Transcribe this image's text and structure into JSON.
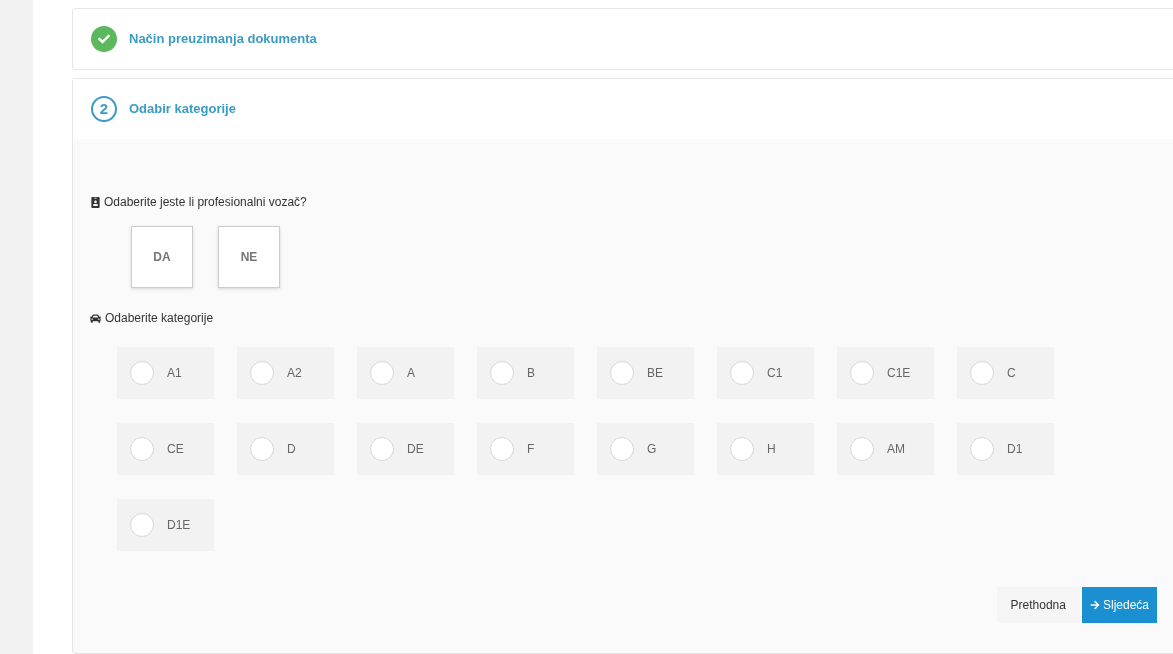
{
  "steps": [
    {
      "kind": "done",
      "title": "Način preuzimanja dokumenta"
    },
    {
      "kind": "active",
      "number": "2",
      "title": "Odabir kategorije"
    }
  ],
  "professional": {
    "question": "Odaberite jeste li profesionalni vozač?",
    "options": [
      {
        "label": "DA",
        "selected": false
      },
      {
        "label": "NE",
        "selected": false
      }
    ]
  },
  "categories": {
    "label": "Odaberite kategorije",
    "items": [
      {
        "label": "A1",
        "selected": false
      },
      {
        "label": "A2",
        "selected": false
      },
      {
        "label": "A",
        "selected": false
      },
      {
        "label": "B",
        "selected": false
      },
      {
        "label": "BE",
        "selected": false
      },
      {
        "label": "C1",
        "selected": false
      },
      {
        "label": "C1E",
        "selected": false
      },
      {
        "label": "C",
        "selected": false
      },
      {
        "label": "CE",
        "selected": false
      },
      {
        "label": "D",
        "selected": false
      },
      {
        "label": "DE",
        "selected": false
      },
      {
        "label": "F",
        "selected": false
      },
      {
        "label": "G",
        "selected": false
      },
      {
        "label": "H",
        "selected": false
      },
      {
        "label": "AM",
        "selected": false
      },
      {
        "label": "D1",
        "selected": false
      },
      {
        "label": "D1E",
        "selected": false
      }
    ]
  },
  "buttons": {
    "previous": "Prethodna",
    "next": "Sljedeća"
  }
}
